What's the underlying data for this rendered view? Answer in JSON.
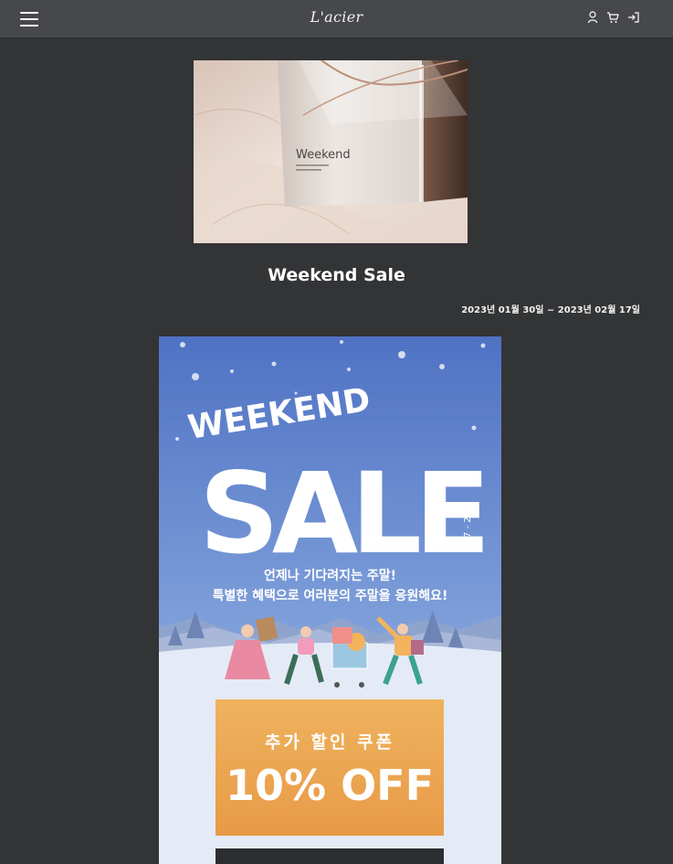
{
  "header": {
    "brand": "L'acier",
    "menu_icon": "hamburger-menu-icon",
    "icons": [
      "user-icon",
      "cart-icon",
      "login-icon"
    ]
  },
  "thumbnail": {
    "cover_text": "Weekend"
  },
  "event": {
    "title": "Weekend Sale",
    "period": "2023년 01월 30일 ~ 2023년 02월 17일"
  },
  "poster": {
    "headline_top": "WEEKEND",
    "headline_main": "SALE",
    "dates": "1.27 - 29",
    "copy_line1": "언제나 기다려지는 주말!",
    "copy_line2": "특별한 혜택으로 여러분의 주말을 응원해요!",
    "coupon_label": "추가 할인 쿠폰",
    "coupon_value": "10% OFF"
  },
  "colors": {
    "page_bg": "#333436",
    "header_bg": "#47484b",
    "poster_blue": "#4f74c6",
    "coupon_orange": "#eba24e"
  }
}
